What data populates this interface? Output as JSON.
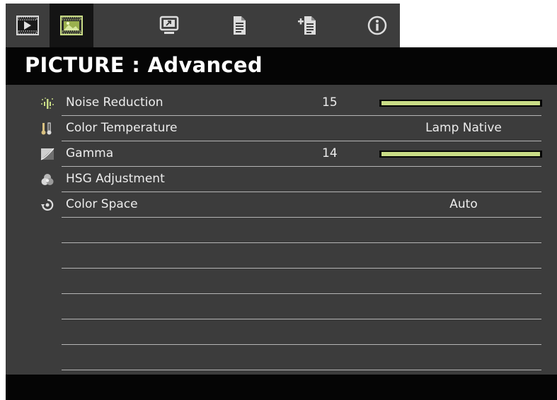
{
  "tabs": [
    {
      "name": "tab-image",
      "icon": "play-screen-icon",
      "active": false
    },
    {
      "name": "tab-picture",
      "icon": "picture-icon",
      "active": true
    },
    {
      "name": "tab-display",
      "icon": "monitor-icon",
      "active": false
    },
    {
      "name": "tab-setup",
      "icon": "document-icon",
      "active": false
    },
    {
      "name": "tab-advanced-setup",
      "icon": "documents-add-icon",
      "active": false
    },
    {
      "name": "tab-info",
      "icon": "info-icon",
      "active": false
    }
  ],
  "title": "PICTURE : Advanced",
  "rows": [
    {
      "label": "Noise Reduction",
      "icon": "noise-reduction-icon",
      "number": "15",
      "slider_percent": 100
    },
    {
      "label": "Color Temperature",
      "icon": "thermometer-icon",
      "value": "Lamp Native"
    },
    {
      "label": "Gamma",
      "icon": "gamma-curve-icon",
      "number": "14",
      "slider_percent": 100
    },
    {
      "label": "HSG Adjustment",
      "icon": "color-circles-icon"
    },
    {
      "label": "Color Space",
      "icon": "color-space-icon",
      "value": "Auto"
    }
  ],
  "colors": {
    "menu_bg": "#3c3c3c",
    "title_bg": "#050505",
    "slider_fill": "#c9dc86",
    "text": "#ececec"
  }
}
